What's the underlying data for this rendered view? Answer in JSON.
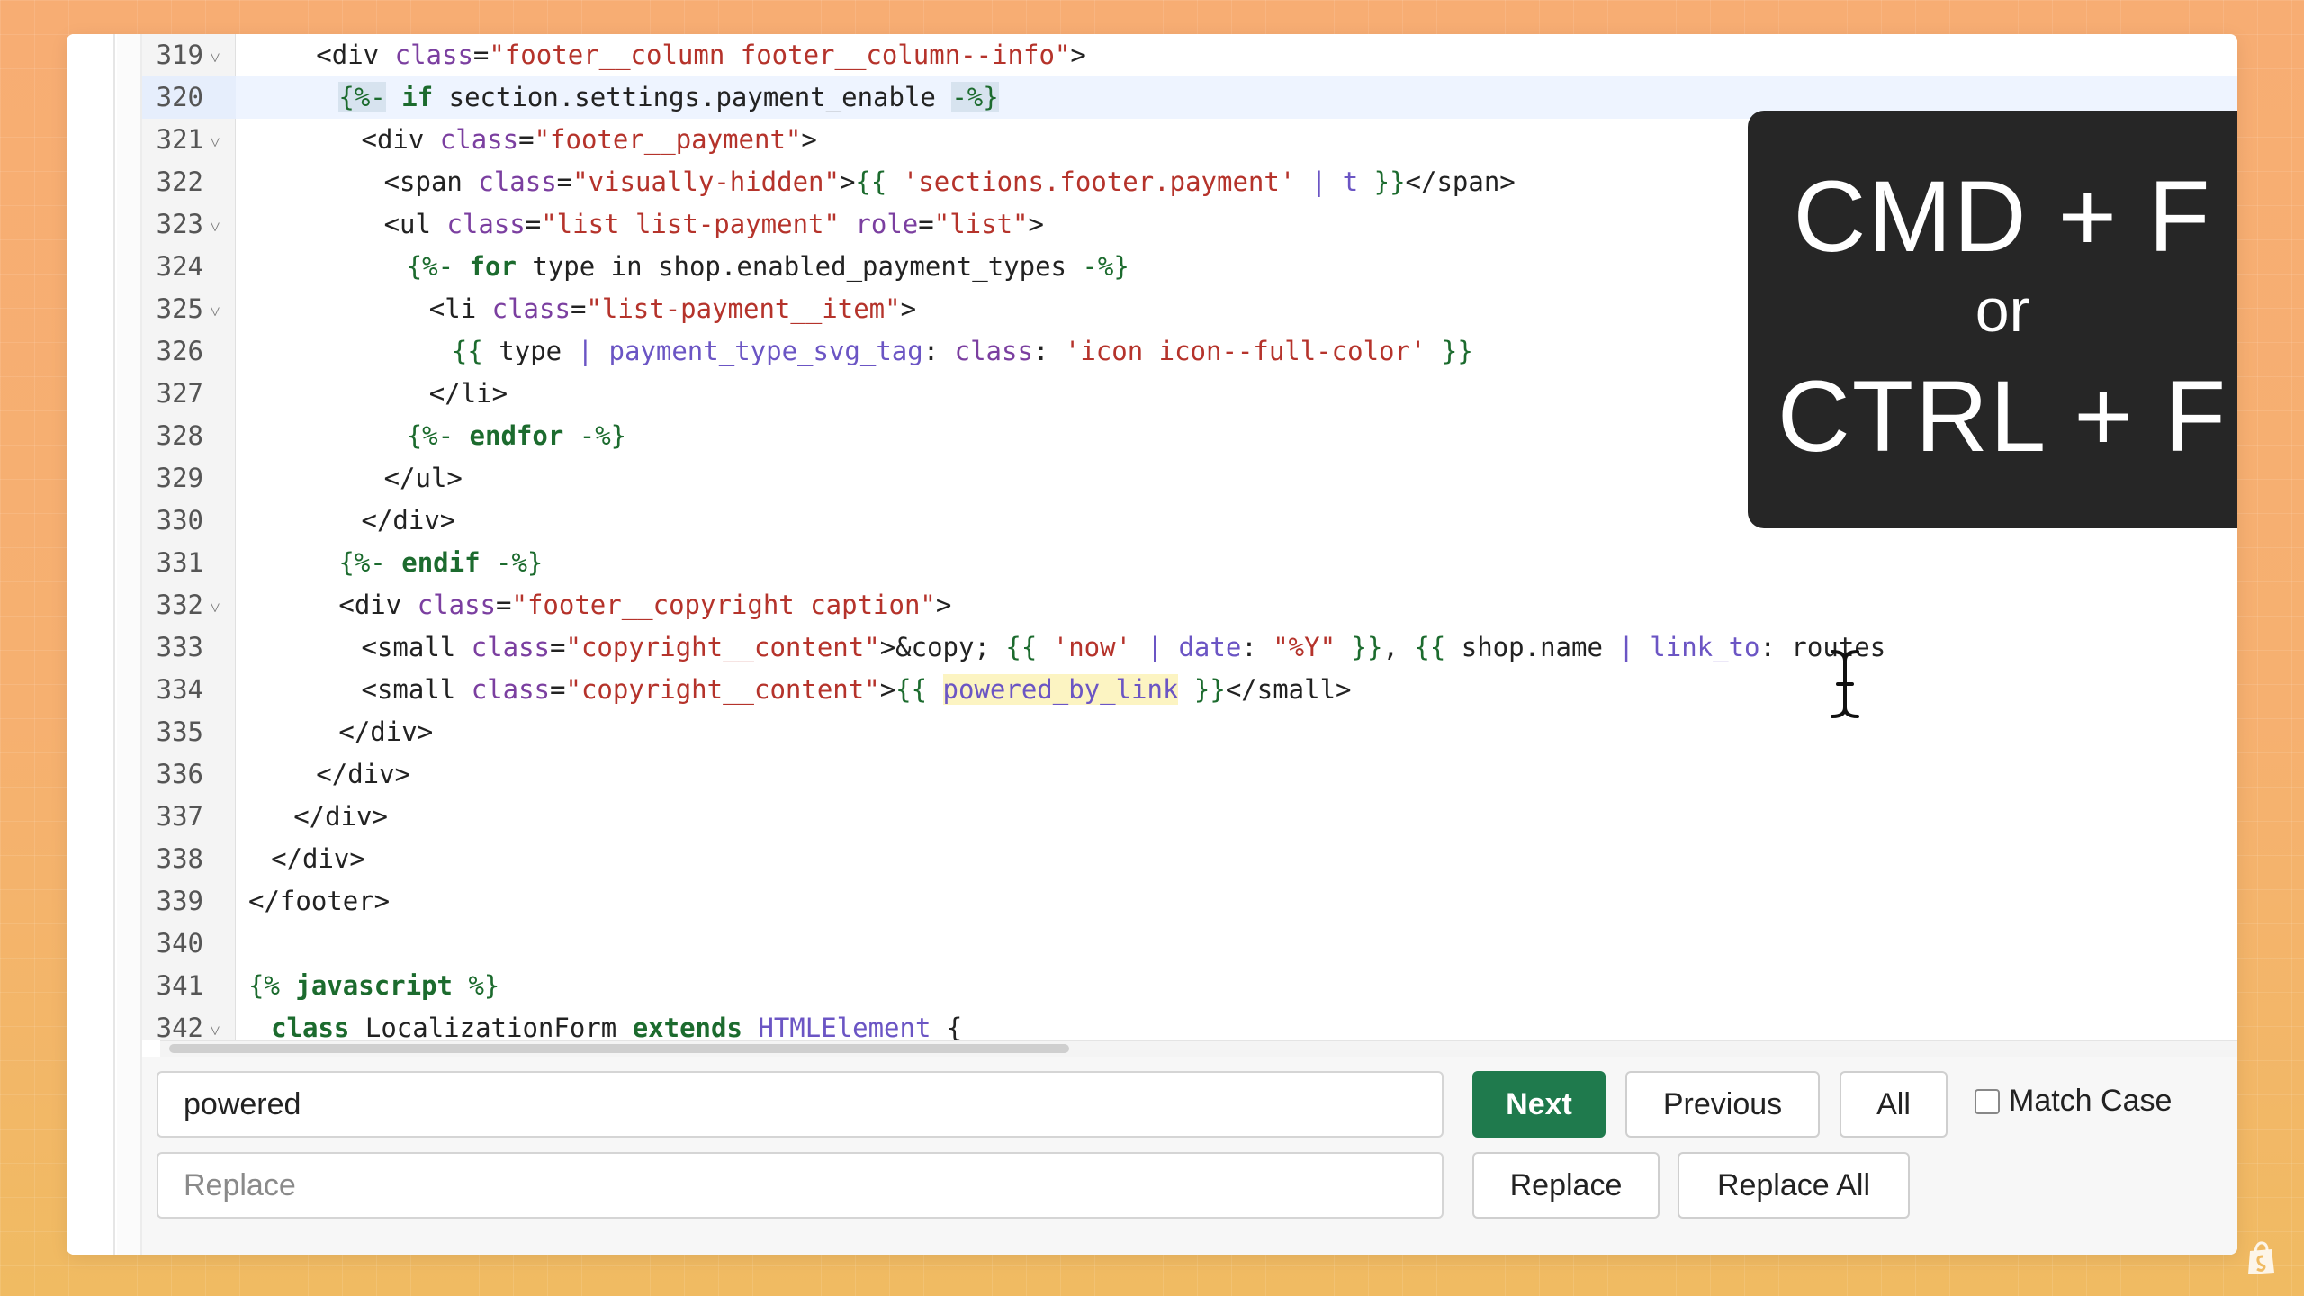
{
  "editor": {
    "lines": [
      {
        "num": "319",
        "fold": true,
        "indent": 6,
        "tokens": [
          [
            "tg",
            "<div "
          ],
          [
            "at",
            "class"
          ],
          [
            "tg",
            "="
          ],
          [
            "st",
            "\"footer__column footer__column--info\""
          ],
          [
            "tg",
            ">"
          ]
        ]
      },
      {
        "num": "320",
        "fold": false,
        "active": true,
        "indent": 8,
        "tokens": [
          [
            "hlsel",
            "{%-"
          ],
          [
            "pl",
            " "
          ],
          [
            "kw",
            "if"
          ],
          [
            "pl",
            " section.settings.payment_enable "
          ],
          [
            "hlsel",
            "-%}"
          ]
        ]
      },
      {
        "num": "321",
        "fold": true,
        "indent": 10,
        "tokens": [
          [
            "tg",
            "<div "
          ],
          [
            "at",
            "class"
          ],
          [
            "tg",
            "="
          ],
          [
            "st",
            "\"footer__payment\""
          ],
          [
            "tg",
            ">"
          ]
        ]
      },
      {
        "num": "322",
        "fold": false,
        "indent": 12,
        "tokens": [
          [
            "tg",
            "<span "
          ],
          [
            "at",
            "class"
          ],
          [
            "tg",
            "="
          ],
          [
            "st",
            "\"visually-hidden\""
          ],
          [
            "tg",
            ">"
          ],
          [
            "lq",
            "{{ "
          ],
          [
            "st",
            "'sections.footer.payment'"
          ],
          [
            "fl",
            " | t "
          ],
          [
            "lq",
            "}}"
          ],
          [
            "tg",
            "</span>"
          ]
        ]
      },
      {
        "num": "323",
        "fold": true,
        "indent": 12,
        "tokens": [
          [
            "tg",
            "<ul "
          ],
          [
            "at",
            "class"
          ],
          [
            "tg",
            "="
          ],
          [
            "st",
            "\"list list-payment\""
          ],
          [
            "at",
            " role"
          ],
          [
            "tg",
            "="
          ],
          [
            "st",
            "\"list\""
          ],
          [
            "tg",
            ">"
          ]
        ]
      },
      {
        "num": "324",
        "fold": false,
        "indent": 14,
        "tokens": [
          [
            "lq",
            "{%- "
          ],
          [
            "kw",
            "for"
          ],
          [
            "pl",
            " type in shop.enabled_payment_types "
          ],
          [
            "lq",
            "-%}"
          ]
        ]
      },
      {
        "num": "325",
        "fold": true,
        "indent": 16,
        "tokens": [
          [
            "tg",
            "<li "
          ],
          [
            "at",
            "class"
          ],
          [
            "tg",
            "="
          ],
          [
            "st",
            "\"list-payment__item\""
          ],
          [
            "tg",
            ">"
          ]
        ]
      },
      {
        "num": "326",
        "fold": false,
        "indent": 18,
        "tokens": [
          [
            "lq",
            "{{ "
          ],
          [
            "pl",
            "type "
          ],
          [
            "fl",
            "| payment_type_svg_tag"
          ],
          [
            "pl",
            ": "
          ],
          [
            "at",
            "class"
          ],
          [
            "pl",
            ": "
          ],
          [
            "st",
            "'icon icon--full-color'"
          ],
          [
            "lq",
            " }}"
          ]
        ]
      },
      {
        "num": "327",
        "fold": false,
        "indent": 16,
        "tokens": [
          [
            "tg",
            "</li>"
          ]
        ]
      },
      {
        "num": "328",
        "fold": false,
        "indent": 14,
        "tokens": [
          [
            "lq",
            "{%- "
          ],
          [
            "kw",
            "endfor"
          ],
          [
            "lq",
            " -%}"
          ]
        ]
      },
      {
        "num": "329",
        "fold": false,
        "indent": 12,
        "tokens": [
          [
            "tg",
            "</ul>"
          ]
        ]
      },
      {
        "num": "330",
        "fold": false,
        "indent": 10,
        "tokens": [
          [
            "tg",
            "</div>"
          ]
        ]
      },
      {
        "num": "331",
        "fold": false,
        "indent": 8,
        "tokens": [
          [
            "lq",
            "{%- "
          ],
          [
            "kw",
            "endif"
          ],
          [
            "lq",
            " -%}"
          ]
        ]
      },
      {
        "num": "332",
        "fold": true,
        "indent": 8,
        "tokens": [
          [
            "tg",
            "<div "
          ],
          [
            "at",
            "class"
          ],
          [
            "tg",
            "="
          ],
          [
            "st",
            "\"footer__copyright caption\""
          ],
          [
            "tg",
            ">"
          ]
        ]
      },
      {
        "num": "333",
        "fold": false,
        "indent": 10,
        "tokens": [
          [
            "tg",
            "<small "
          ],
          [
            "at",
            "class"
          ],
          [
            "tg",
            "="
          ],
          [
            "st",
            "\"copyright__content\""
          ],
          [
            "tg",
            ">&copy; "
          ],
          [
            "lq",
            "{{ "
          ],
          [
            "st",
            "'now'"
          ],
          [
            "fl",
            " | date"
          ],
          [
            "pl",
            ": "
          ],
          [
            "st",
            "\"%Y\""
          ],
          [
            "lq",
            " }}"
          ],
          [
            "pl",
            ", "
          ],
          [
            "lq",
            "{{ "
          ],
          [
            "pl",
            "shop.name "
          ],
          [
            "fl",
            "| link_to"
          ],
          [
            "pl",
            ": routes"
          ]
        ]
      },
      {
        "num": "334",
        "fold": false,
        "indent": 10,
        "tokens": [
          [
            "tg",
            "<small "
          ],
          [
            "at",
            "class"
          ],
          [
            "tg",
            "="
          ],
          [
            "st",
            "\"copyright__content\""
          ],
          [
            "tg",
            ">"
          ],
          [
            "lq",
            "{{ "
          ],
          [
            "hlfind",
            "powered_by_link"
          ],
          [
            "lq",
            " }}"
          ],
          [
            "tg",
            "</small>"
          ]
        ]
      },
      {
        "num": "335",
        "fold": false,
        "indent": 8,
        "tokens": [
          [
            "tg",
            "</div>"
          ]
        ]
      },
      {
        "num": "336",
        "fold": false,
        "indent": 6,
        "tokens": [
          [
            "tg",
            "</div>"
          ]
        ]
      },
      {
        "num": "337",
        "fold": false,
        "indent": 4,
        "tokens": [
          [
            "tg",
            "</div>"
          ]
        ]
      },
      {
        "num": "338",
        "fold": false,
        "indent": 2,
        "tokens": [
          [
            "tg",
            "</div>"
          ]
        ]
      },
      {
        "num": "339",
        "fold": false,
        "indent": 0,
        "tokens": [
          [
            "tg",
            "</footer>"
          ]
        ]
      },
      {
        "num": "340",
        "fold": false,
        "indent": 0,
        "tokens": []
      },
      {
        "num": "341",
        "fold": false,
        "indent": 0,
        "tokens": [
          [
            "lq",
            "{% "
          ],
          [
            "kw",
            "javascript"
          ],
          [
            "lq",
            " %}"
          ]
        ]
      },
      {
        "num": "342",
        "fold": true,
        "indent": 2,
        "tokens": [
          [
            "kw",
            "class"
          ],
          [
            "pl",
            " LocalizationForm "
          ],
          [
            "kw",
            "extends"
          ],
          [
            "fl",
            " HTMLElement"
          ],
          [
            "pl",
            " {"
          ]
        ]
      }
    ]
  },
  "find": {
    "search_value": "powered",
    "replace_placeholder": "Replace",
    "next_label": "Next",
    "previous_label": "Previous",
    "all_label": "All",
    "match_case_label": "Match Case",
    "replace_label": "Replace",
    "replace_all_label": "Replace All"
  },
  "overlay": {
    "line1": "CMD + F",
    "line2": "or",
    "line3": "CTRL + F"
  },
  "colors": {
    "primary_button": "#1f7a4d",
    "overlay_bg": "#262626",
    "background": "#f7ad73"
  },
  "icons": {
    "fold": "chevron-down-icon",
    "cursor": "text-cursor-icon",
    "brand": "shopify-bag-icon"
  }
}
